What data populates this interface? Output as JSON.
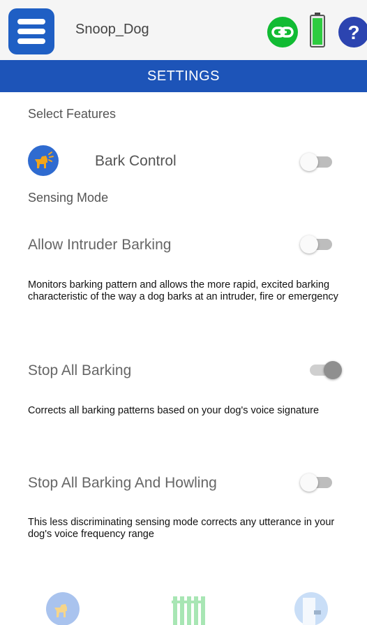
{
  "header": {
    "device_name": "Snoop_Dog",
    "icons": {
      "menu": "hamburger-menu-icon",
      "connection": "link-icon",
      "battery": "battery-icon",
      "help": "help-icon"
    },
    "colors": {
      "accent": "#1d54b8",
      "link_green": "#11bb33",
      "battery_green": "#2ecc40",
      "help_blue": "#2c44b0"
    }
  },
  "title_bar": {
    "title": "SETTINGS"
  },
  "features": {
    "label": "Select Features",
    "bark_control": {
      "label": "Bark Control",
      "enabled": false
    }
  },
  "sensing": {
    "label": "Sensing Mode",
    "modes": [
      {
        "title": "Allow Intruder Barking",
        "description": "Monitors barking pattern and allows the more rapid, excited barking characteristic of the way a dog barks at an intruder, fire or emergency",
        "enabled": false
      },
      {
        "title": "Stop All Barking",
        "description": "Corrects all barking patterns based on your dog's voice signature",
        "enabled": true
      },
      {
        "title": "Stop All Barking And Howling",
        "description": "This less discriminating sensing mode corrects any utterance in your dog's voice frequency range",
        "enabled": false
      }
    ]
  },
  "bottom_nav": {
    "items": [
      "bark-dog-icon",
      "fence-icon",
      "door-icon"
    ]
  }
}
